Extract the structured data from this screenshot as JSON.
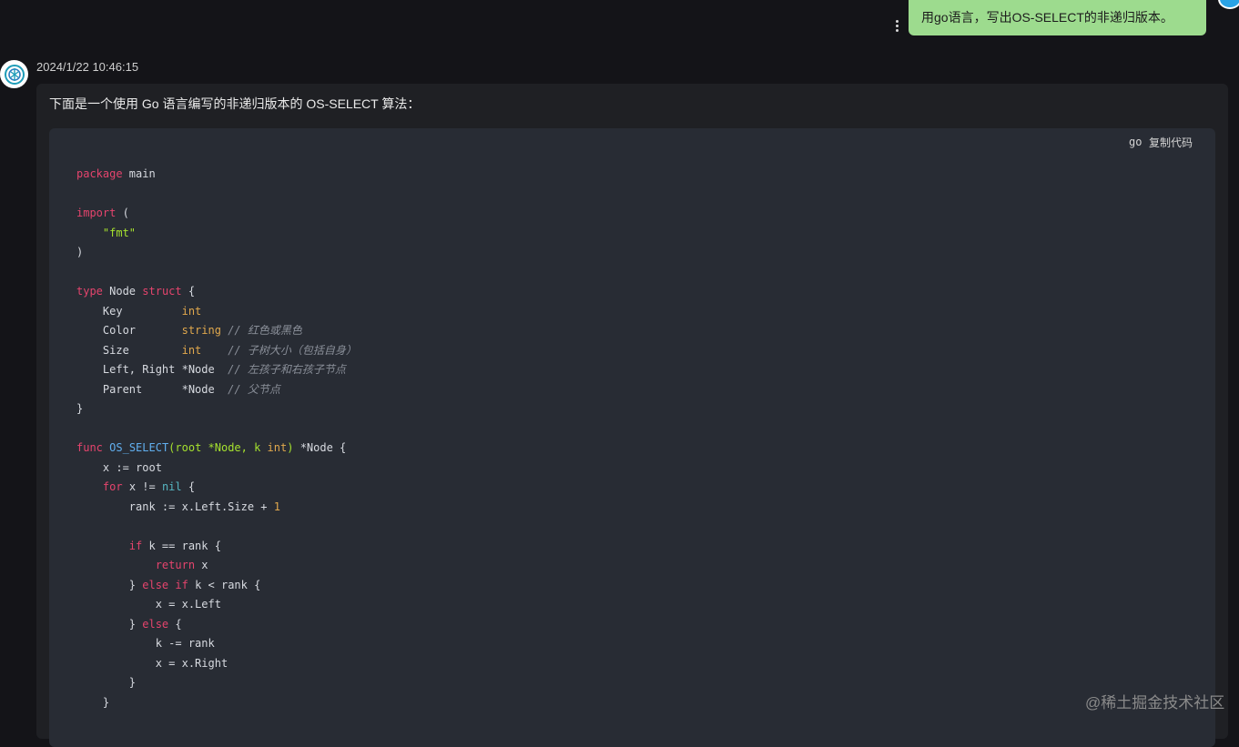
{
  "user_message": {
    "text": "用go语言，写出OS-SELECT的非递归版本。"
  },
  "bot_message": {
    "timestamp": "2024/1/22 10:46:15",
    "intro": "下面是一个使用 Go 语言编写的非递归版本的 OS-SELECT 算法：",
    "code_lang": "go",
    "copy_label": "复制代码"
  },
  "code_lines": [
    [
      {
        "t": "kw",
        "v": "package"
      },
      {
        "t": "",
        "v": " main"
      }
    ],
    [],
    [
      {
        "t": "kw",
        "v": "import"
      },
      {
        "t": "",
        "v": " ("
      }
    ],
    [
      {
        "t": "",
        "v": "    "
      },
      {
        "t": "str",
        "v": "\"fmt\""
      }
    ],
    [
      {
        "t": "",
        "v": ")"
      }
    ],
    [],
    [
      {
        "t": "kw",
        "v": "type"
      },
      {
        "t": "",
        "v": " Node "
      },
      {
        "t": "kw",
        "v": "struct"
      },
      {
        "t": "",
        "v": " {"
      }
    ],
    [
      {
        "t": "",
        "v": "    Key         "
      },
      {
        "t": "ty",
        "v": "int"
      }
    ],
    [
      {
        "t": "",
        "v": "    Color       "
      },
      {
        "t": "ty",
        "v": "string"
      },
      {
        "t": "",
        "v": " "
      },
      {
        "t": "cm",
        "v": "// 红色或黑色"
      }
    ],
    [
      {
        "t": "",
        "v": "    Size        "
      },
      {
        "t": "ty",
        "v": "int"
      },
      {
        "t": "",
        "v": "    "
      },
      {
        "t": "cm",
        "v": "// 子树大小（包括自身）"
      }
    ],
    [
      {
        "t": "",
        "v": "    Left, Right *Node  "
      },
      {
        "t": "cm",
        "v": "// 左孩子和右孩子节点"
      }
    ],
    [
      {
        "t": "",
        "v": "    Parent      *Node  "
      },
      {
        "t": "cm",
        "v": "// 父节点"
      }
    ],
    [
      {
        "t": "",
        "v": "}"
      }
    ],
    [],
    [
      {
        "t": "kw",
        "v": "func"
      },
      {
        "t": "",
        "v": " "
      },
      {
        "t": "fn",
        "v": "OS_SELECT"
      },
      {
        "t": "str",
        "v": "(root *Node, k "
      },
      {
        "t": "ty",
        "v": "int"
      },
      {
        "t": "str",
        "v": ")"
      },
      {
        "t": "",
        "v": " *Node {"
      }
    ],
    [
      {
        "t": "",
        "v": "    x := root"
      }
    ],
    [
      {
        "t": "",
        "v": "    "
      },
      {
        "t": "kw",
        "v": "for"
      },
      {
        "t": "",
        "v": " x != "
      },
      {
        "t": "nil",
        "v": "nil"
      },
      {
        "t": "",
        "v": " {"
      }
    ],
    [
      {
        "t": "",
        "v": "        rank := x.Left.Size + "
      },
      {
        "t": "num",
        "v": "1"
      }
    ],
    [],
    [
      {
        "t": "",
        "v": "        "
      },
      {
        "t": "kw",
        "v": "if"
      },
      {
        "t": "",
        "v": " k == rank {"
      }
    ],
    [
      {
        "t": "",
        "v": "            "
      },
      {
        "t": "kw",
        "v": "return"
      },
      {
        "t": "",
        "v": " x"
      }
    ],
    [
      {
        "t": "",
        "v": "        } "
      },
      {
        "t": "kw",
        "v": "else"
      },
      {
        "t": "",
        "v": " "
      },
      {
        "t": "kw",
        "v": "if"
      },
      {
        "t": "",
        "v": " k < rank {"
      }
    ],
    [
      {
        "t": "",
        "v": "            x = x.Left"
      }
    ],
    [
      {
        "t": "",
        "v": "        } "
      },
      {
        "t": "kw",
        "v": "else"
      },
      {
        "t": "",
        "v": " {"
      }
    ],
    [
      {
        "t": "",
        "v": "            k -= rank"
      }
    ],
    [
      {
        "t": "",
        "v": "            x = x.Right"
      }
    ],
    [
      {
        "t": "",
        "v": "        }"
      }
    ],
    [
      {
        "t": "",
        "v": "    }"
      }
    ]
  ],
  "watermark": "@稀土掘金技术社区"
}
